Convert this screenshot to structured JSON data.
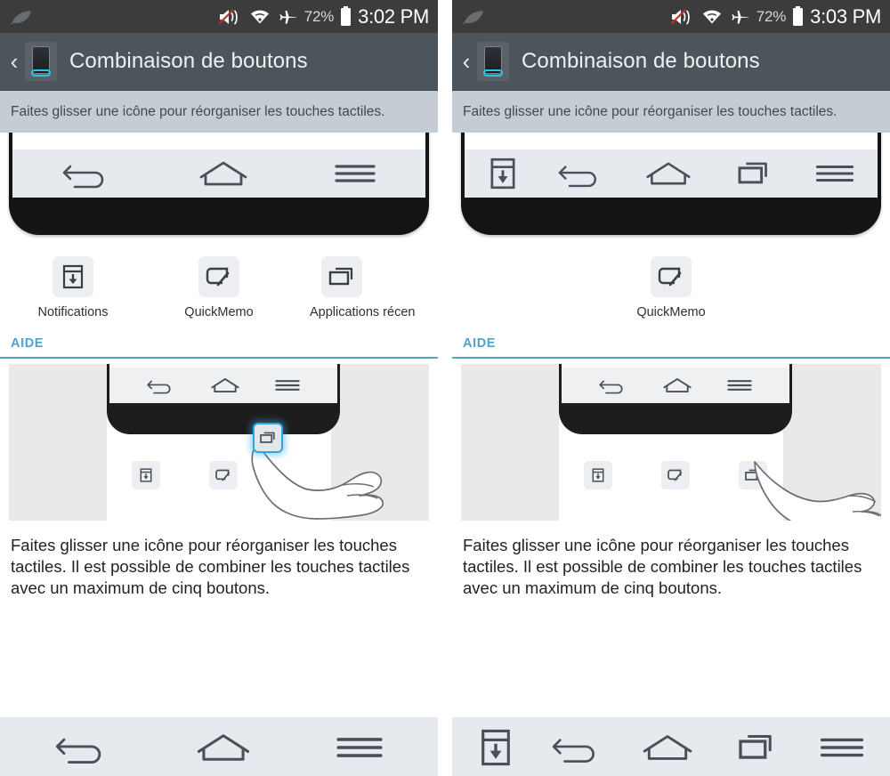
{
  "panels": [
    {
      "statusbar": {
        "leaf_icon": "leaf-icon",
        "mute_icon": "speaker-mute-icon",
        "wifi_icon": "wifi-icon",
        "airplane_icon": "airplane-mode-icon",
        "battery_percent": "72%",
        "battery_icon": "battery-icon",
        "clock": "3:02 PM"
      },
      "titlebar": {
        "back_chevron": "‹",
        "app_icon": "phone-navbar-icon",
        "title": "Combinaison de boutons"
      },
      "instruction": "Faites glisser une icône pour réorganiser les touches tactiles.",
      "preview_buttons": [
        "back",
        "home",
        "menu"
      ],
      "available_icons": [
        {
          "icon": "notifications-icon",
          "label": "Notifications"
        },
        {
          "icon": "quickmemo-icon",
          "label": "QuickMemo"
        },
        {
          "icon": "recent-apps-icon",
          "label": "Applications récen"
        }
      ],
      "help": {
        "section_label": "AIDE",
        "illustration": {
          "nav_buttons": [
            "back",
            "home",
            "menu"
          ],
          "tray_icons": [
            "notifications-icon",
            "quickmemo-icon"
          ],
          "dragged_icon": "recent-apps-icon",
          "drag_state": "lifted-to-navbar"
        },
        "text": "Faites glisser une icône pour réorganiser les touches tactiles. Il est possible de combiner les touches tactiles avec un maximum de cinq boutons."
      },
      "system_bar": [
        "back",
        "home",
        "menu"
      ]
    },
    {
      "statusbar": {
        "leaf_icon": "leaf-icon",
        "mute_icon": "speaker-mute-icon",
        "wifi_icon": "wifi-icon",
        "airplane_icon": "airplane-mode-icon",
        "battery_percent": "72%",
        "battery_icon": "battery-icon",
        "clock": "3:03 PM"
      },
      "titlebar": {
        "back_chevron": "‹",
        "app_icon": "phone-navbar-icon",
        "title": "Combinaison de boutons"
      },
      "instruction": "Faites glisser une icône pour réorganiser les touches tactiles.",
      "preview_buttons": [
        "notifications",
        "back",
        "home",
        "recent",
        "menu"
      ],
      "available_icons": [
        {
          "icon": "quickmemo-icon",
          "label": "QuickMemo"
        }
      ],
      "help": {
        "section_label": "AIDE",
        "illustration": {
          "nav_buttons": [
            "back",
            "home",
            "menu"
          ],
          "tray_icons": [
            "notifications-icon",
            "quickmemo-icon"
          ],
          "dragged_icon": "recent-apps-icon",
          "drag_state": "in-tray"
        },
        "text": "Faites glisser une icône pour réorganiser les touches tactiles. Il est possible de combiner les touches tactiles avec un maximum de cinq boutons."
      },
      "system_bar": [
        "notifications",
        "back",
        "home",
        "recent",
        "menu"
      ]
    }
  ],
  "colors": {
    "statusbar_bg": "#3c3c3c",
    "titlebar_bg": "#4c545c",
    "instruction_bg": "#c6ccd4",
    "accent_blue": "#52a3cc",
    "drag_highlight": "#2ea6e0",
    "navbar_bg": "#e6e9ed",
    "mute_slash": "#cc2b27"
  }
}
